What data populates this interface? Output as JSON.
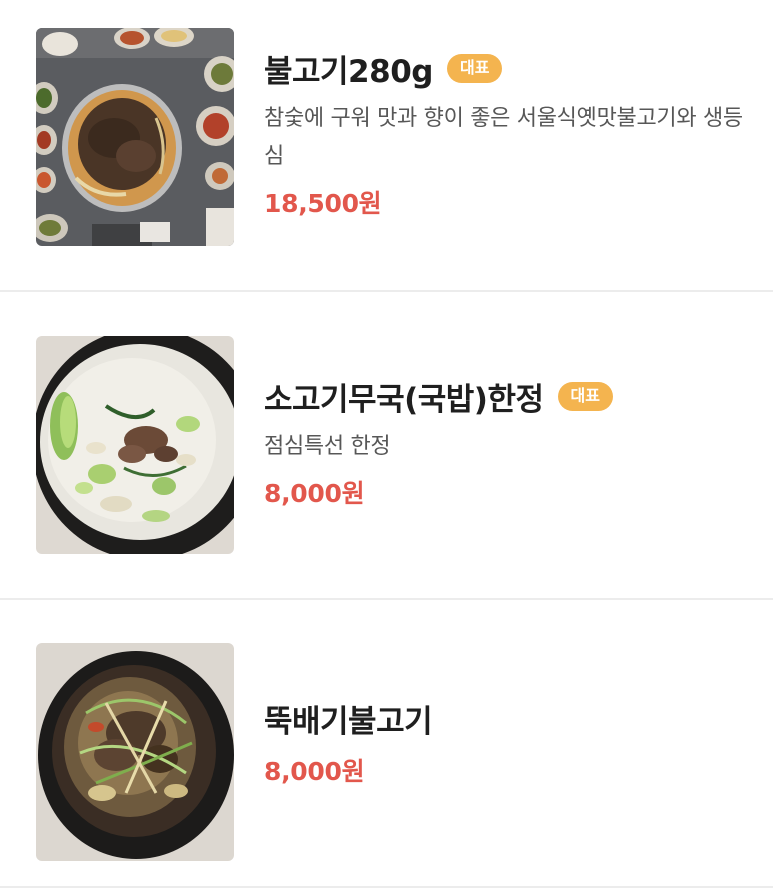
{
  "menu": {
    "items": [
      {
        "name": "불고기280g",
        "badge": "대표",
        "description": "참숯에 구워 맛과 향이 좋은 서울식옛맛불고기와 생등심",
        "price": "18,500원",
        "image": "bulgogi-grill-photo"
      },
      {
        "name": "소고기무국(국밥)한정",
        "badge": "대표",
        "description": "점심특선 한정",
        "price": "8,000원",
        "image": "beef-radish-soup-photo"
      },
      {
        "name": "뚝배기불고기",
        "price": "8,000원",
        "image": "ttukbaegi-bulgogi-photo"
      }
    ]
  },
  "colors": {
    "badge": "#f4b44f",
    "price": "#e2574c",
    "divider": "#ececec",
    "description": "#575757"
  }
}
